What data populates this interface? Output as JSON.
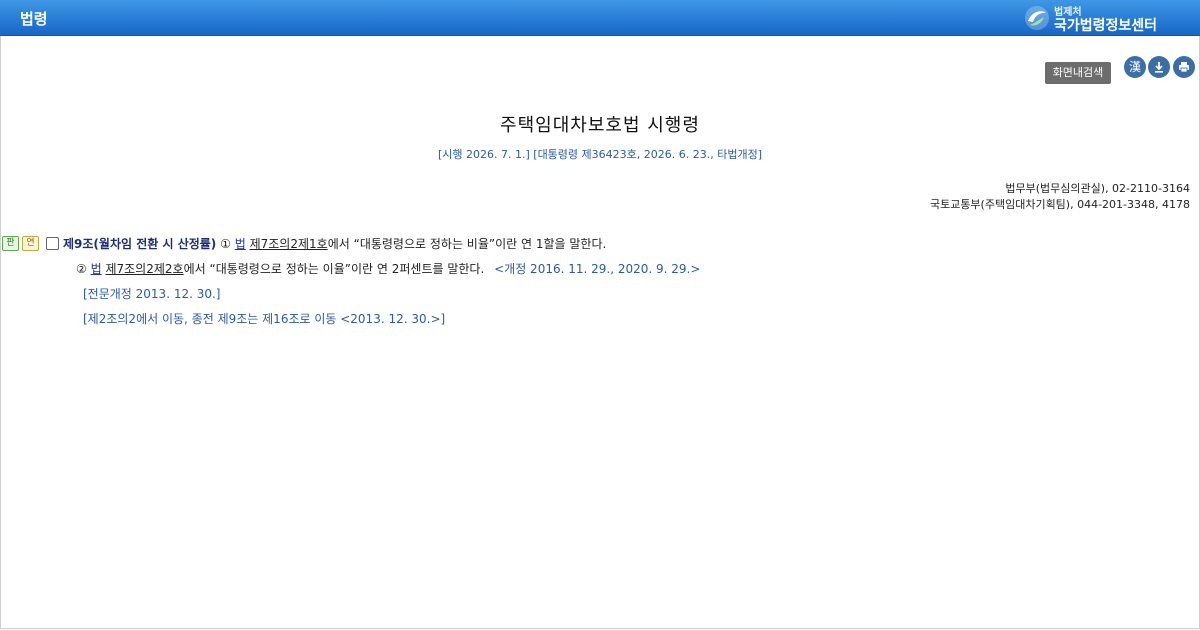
{
  "header": {
    "title": "법령",
    "brand_sub": "법제처",
    "brand_main": "국가법령정보센터"
  },
  "toolbar": {
    "search_label": "화면내검색",
    "hanja_label": "漢",
    "download_icon": "download-icon",
    "print_icon": "print-icon"
  },
  "document": {
    "title": "주택임대차보호법 시행령",
    "subtitle": "[시행 2026. 7. 1.] [대통령령 제36423호, 2026. 6. 23., 타법개정]",
    "ministries": [
      "법무부(법무심의관실), 02-2110-3164",
      "국토교통부(주택임대차기획팀), 044-201-3348, 4178"
    ]
  },
  "article": {
    "tags": [
      "판",
      "연"
    ],
    "title": "제9조(월차임 전환 시 산정률)",
    "para1_num": "①",
    "para1_link1": "법",
    "para1_link2": "제7조의2제1호",
    "para1_text": "에서 “대통령령으로 정하는 비율”이란 연 1할을 말한다.",
    "para2_num": "②",
    "para2_link1": "법",
    "para2_link2": "제7조의2제2호",
    "para2_text": "에서 “대통령령으로 정하는 이율”이란 연 2퍼센트를 말한다.",
    "para2_amend": "<개정 2016. 11. 29., 2020. 9. 29.>",
    "note1": "[전문개정 2013. 12. 30.]",
    "note2": "[제2조의2에서 이동, 종전 제9조는 제16조로 이동 <2013. 12. 30.>]"
  },
  "colors": {
    "header_bg": "#1f74d2",
    "link": "#1a35b0",
    "amend_blue": "#2b5aa6"
  }
}
